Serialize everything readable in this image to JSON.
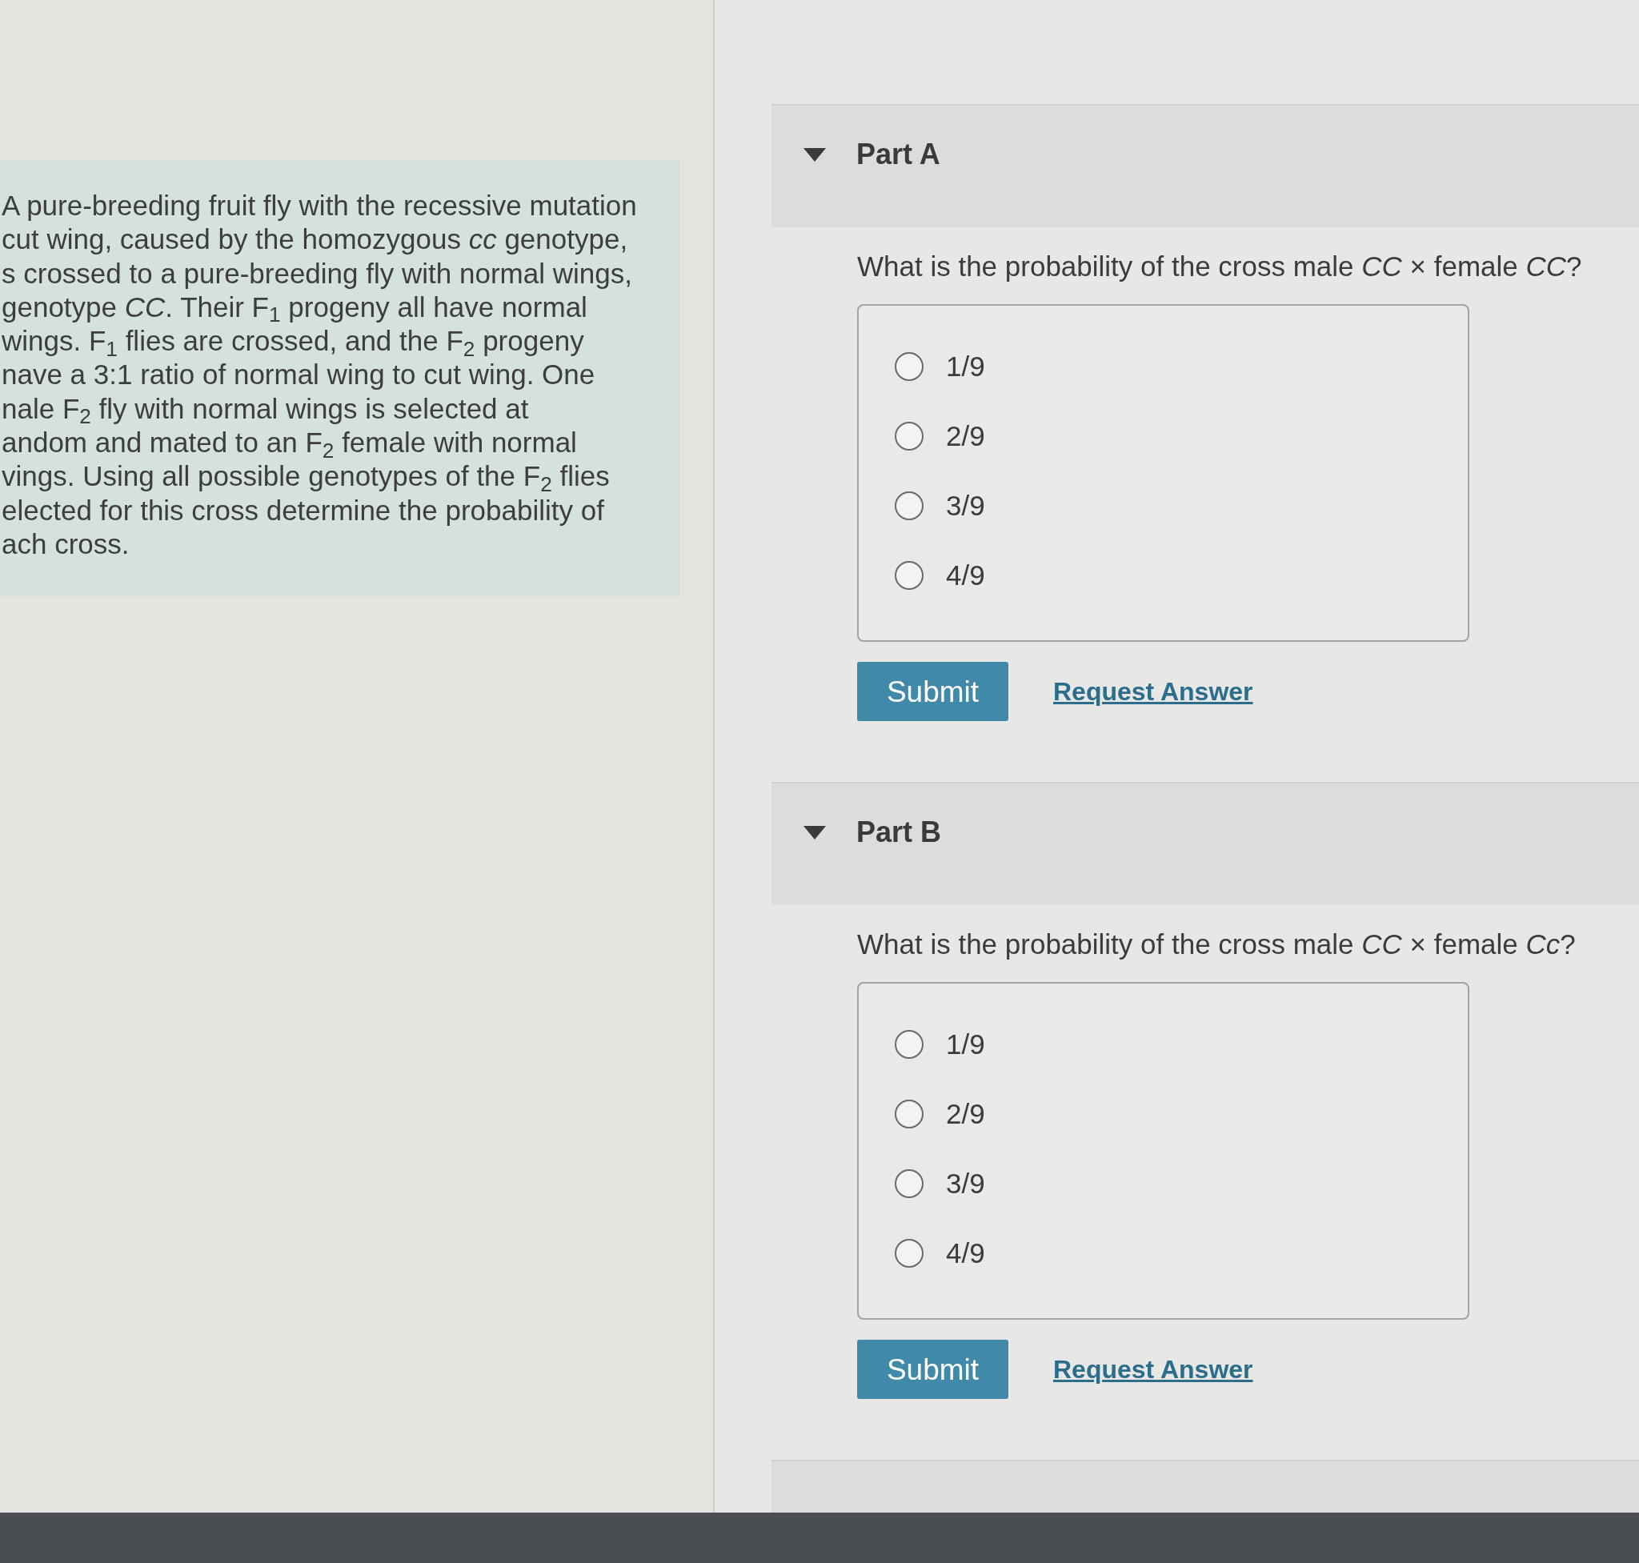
{
  "problem": {
    "lines": [
      "A pure-breeding fruit fly with the recessive mutation",
      "cut wing, caused by the homozygous *cc* genotype,",
      "s crossed to a pure-breeding fly with normal wings,",
      "genotype *CC*. Their F$_{1}$ progeny all have normal",
      "wings. F$_{1}$ flies are crossed, and the F$_{2}$ progeny",
      "nave a 3:1 ratio of normal wing to cut wing. One",
      "nale F$_{2}$ fly with normal wings is selected at",
      "andom and mated to an F$_{2}$ female with normal",
      "vings. Using all possible genotypes of the F$_{2}$ flies",
      "elected for this cross determine the probability of",
      "ach cross."
    ]
  },
  "parts": [
    {
      "title": "Part A",
      "expanded": true,
      "question": "What is the probability of the cross male *CC* × female *CC*?",
      "options": [
        {
          "label": "1/9",
          "selected": false
        },
        {
          "label": "2/9",
          "selected": false
        },
        {
          "label": "3/9",
          "selected": false
        },
        {
          "label": "4/9",
          "selected": false
        }
      ],
      "submit": "Submit",
      "request_answer": "Request Answer"
    },
    {
      "title": "Part B",
      "expanded": true,
      "question": "What is the probability of the cross male *CC* × female *Cc*?",
      "options": [
        {
          "label": "1/9",
          "selected": false
        },
        {
          "label": "2/9",
          "selected": false
        },
        {
          "label": "3/9",
          "selected": false
        },
        {
          "label": "4/9",
          "selected": false
        }
      ],
      "submit": "Submit",
      "request_answer": "Request Answer"
    }
  ]
}
